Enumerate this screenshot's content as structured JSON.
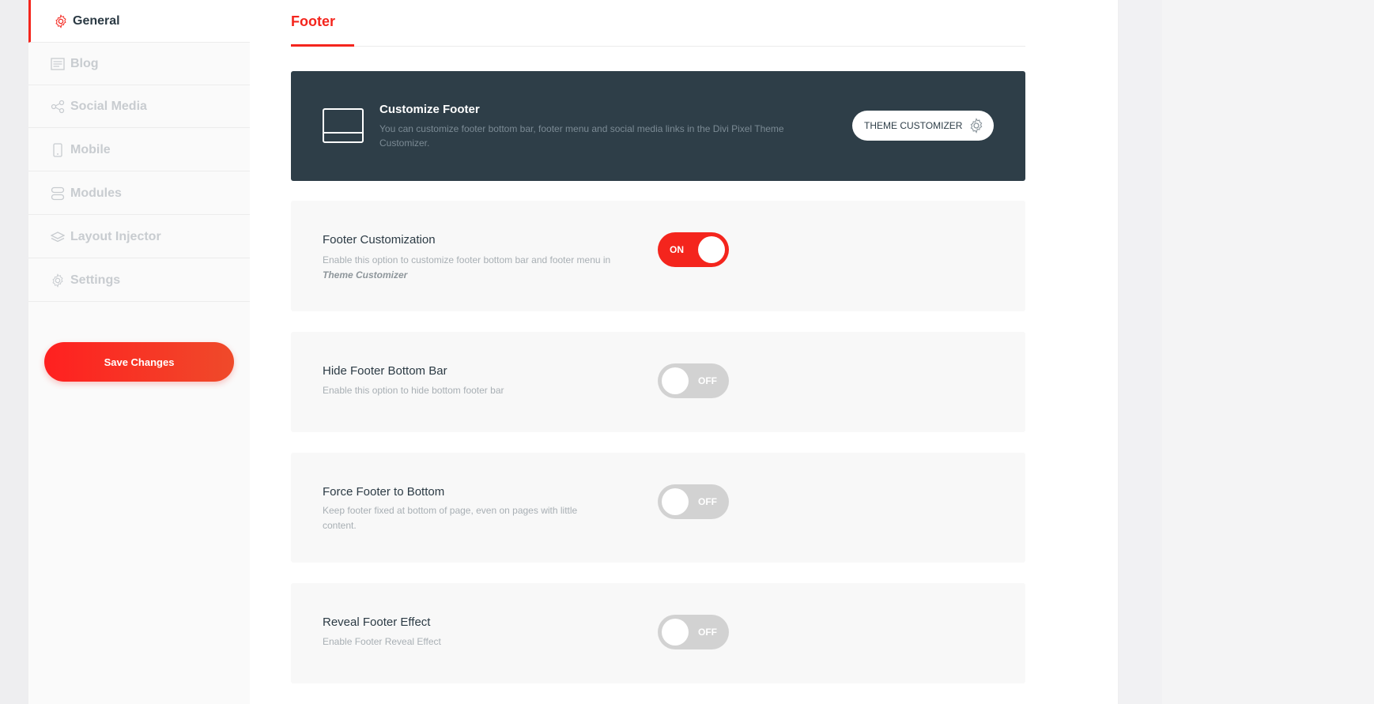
{
  "sidebar": {
    "items": [
      {
        "label": "General",
        "icon": "gear-icon",
        "active": true
      },
      {
        "label": "Blog",
        "icon": "blog-icon",
        "active": false
      },
      {
        "label": "Social Media",
        "icon": "share-icon",
        "active": false
      },
      {
        "label": "Mobile",
        "icon": "mobile-icon",
        "active": false
      },
      {
        "label": "Modules",
        "icon": "modules-icon",
        "active": false
      },
      {
        "label": "Layout Injector",
        "icon": "layers-icon",
        "active": false
      },
      {
        "label": "Settings",
        "icon": "gear-icon",
        "active": false
      }
    ],
    "save_label": "Save Changes"
  },
  "main": {
    "tab_label": "Footer",
    "banner": {
      "title": "Customize Footer",
      "description": "You can customize footer bottom bar, footer menu and social media links in the Divi Pixel Theme Customizer.",
      "button_label": "THEME CUSTOMIZER"
    },
    "settings": [
      {
        "title": "Footer Customization",
        "description_prefix": "Enable this option to customize footer bottom bar and footer menu in ",
        "description_emphasis": "Theme Customizer",
        "state": "ON"
      },
      {
        "title": "Hide Footer Bottom Bar",
        "description": "Enable this option to hide bottom footer bar",
        "state": "OFF"
      },
      {
        "title": "Force Footer to Bottom",
        "description": "Keep footer fixed at bottom of page, even on pages with little content.",
        "state": "OFF"
      },
      {
        "title": "Reveal Footer Effect",
        "description": "Enable Footer Reveal Effect",
        "state": "OFF"
      }
    ]
  },
  "colors": {
    "accent": "#f4251d",
    "banner_bg": "#2e3e48",
    "toggle_off": "#d2d2d2",
    "card_bg": "#f8f8f8"
  }
}
